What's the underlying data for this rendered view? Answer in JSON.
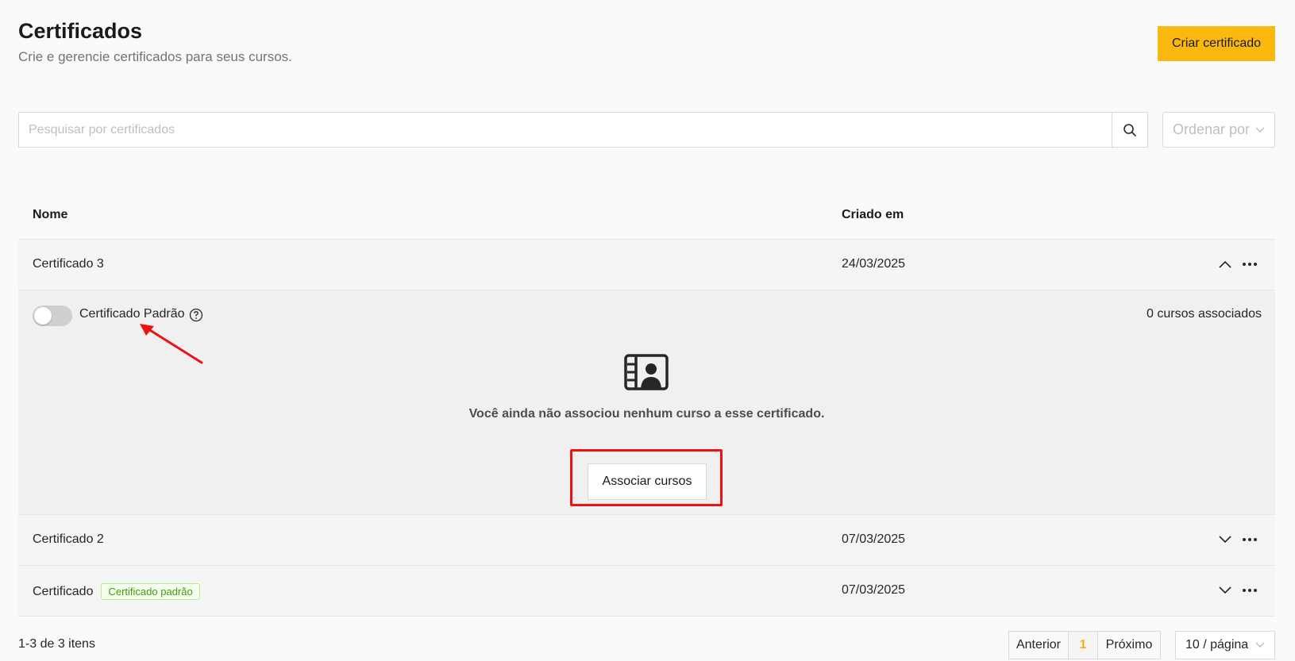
{
  "header": {
    "title": "Certificados",
    "subtitle": "Crie e gerencie certificados para seus cursos.",
    "create_label": "Criar certificado",
    "accent_color": "#fbb90f"
  },
  "search": {
    "placeholder": "Pesquisar por certificados",
    "value": "",
    "sort_label": "Ordenar por"
  },
  "table": {
    "columns": {
      "name": "Nome",
      "created": "Criado em"
    },
    "rows": [
      {
        "name": "Certificado 3",
        "created": "24/03/2025",
        "badge": "",
        "expanded": true
      },
      {
        "name": "Certificado 2",
        "created": "07/03/2025",
        "badge": "",
        "expanded": false
      },
      {
        "name": "Certificado",
        "created": "07/03/2025",
        "badge": "Certificado padrão",
        "expanded": false
      }
    ]
  },
  "expanded_panel": {
    "toggle_label": "Certificado Padrão",
    "toggle_on": false,
    "assoc_count": "0 cursos associados",
    "empty_text": "Você ainda não associou nenhum curso a esse certificado.",
    "assoc_button": "Associar cursos",
    "icon": "certificate-portrait-icon"
  },
  "pagination": {
    "info": "1-3 de 3 itens",
    "prev": "Anterior",
    "current": "1",
    "next": "Próximo",
    "per_page": "10 / página"
  },
  "annotations": {
    "highlight_color": "#ee1111"
  }
}
